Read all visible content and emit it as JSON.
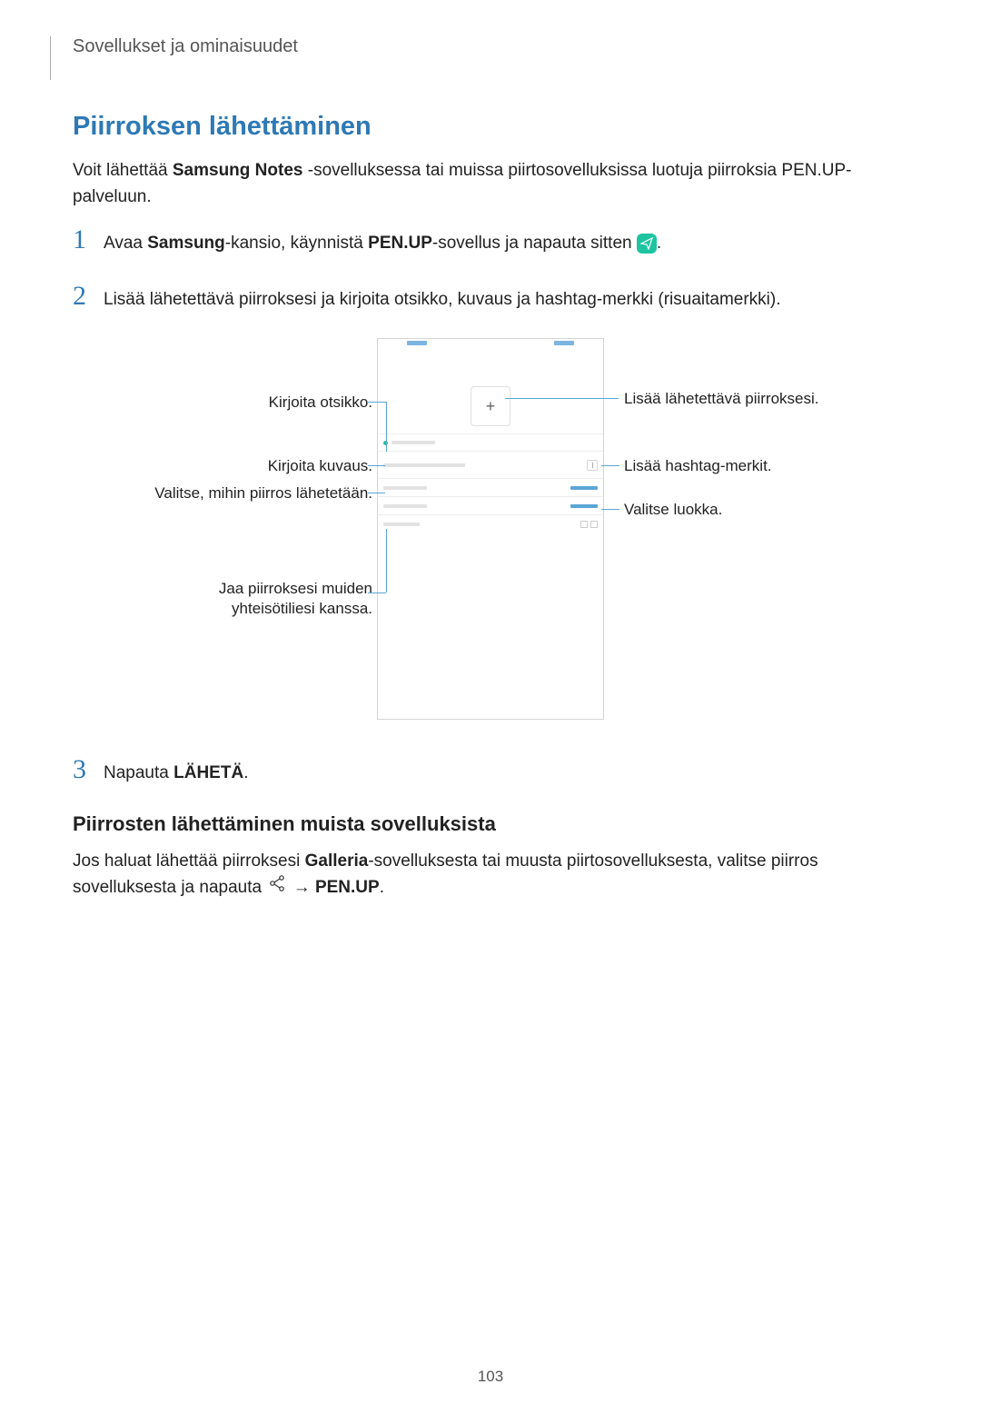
{
  "chapter": "Sovellukset ja ominaisuudet",
  "section_title": "Piirroksen lähettäminen",
  "intro": {
    "p1a": "Voit lähettää ",
    "p1b": "Samsung Notes",
    "p1c": " -sovelluksessa tai muissa piirtosovelluksissa luotuja piirroksia PEN.UP-palveluun."
  },
  "steps": {
    "s1": {
      "num": "1",
      "a": "Avaa ",
      "b": "Samsung",
      "c": "-kansio, käynnistä ",
      "d": "PEN.UP",
      "e": "-sovellus ja napauta sitten ",
      "f": "."
    },
    "s2": {
      "num": "2",
      "text": "Lisää lähetettävä piirroksesi ja kirjoita otsikko, kuvaus ja hashtag-merkki (risuaitamerkki)."
    },
    "s3": {
      "num": "3",
      "a": "Napauta ",
      "b": "LÄHETÄ",
      "c": "."
    }
  },
  "callouts": {
    "left1": "Kirjoita otsikko.",
    "left2": "Kirjoita kuvaus.",
    "left3": "Valitse, mihin piirros lähetetään.",
    "left4a": "Jaa piirroksesi muiden",
    "left4b": "yhteisötiliesi kanssa.",
    "right1": "Lisää lähetettävä piirroksesi.",
    "right2": "Lisää hashtag-merkit.",
    "right3": "Valitse luokka."
  },
  "subheading": "Piirrosten lähettäminen muista sovelluksista",
  "para2": {
    "a": "Jos haluat lähettää piirroksesi ",
    "b": "Galleria",
    "c": "-sovelluksesta tai muusta piirtosovelluksesta, valitse piirros sovelluksesta ja napauta ",
    "d": " → ",
    "e": "PEN.UP",
    "f": "."
  },
  "page_number": "103"
}
